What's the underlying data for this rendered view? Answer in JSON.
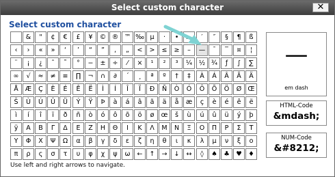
{
  "window": {
    "title": "Select custom character",
    "close_label": "✕"
  },
  "heading": "Select custom character",
  "grid": {
    "columns": 20,
    "highlighted": "—",
    "rows": [
      [
        "",
        "&",
        "\"",
        "¢",
        "€",
        "£",
        "¥",
        "©",
        "®",
        "™",
        "‰",
        "µ",
        "·",
        "•",
        "…",
        "′",
        "″",
        "§",
        "¶",
        "ß"
      ],
      [
        "‹",
        "›",
        "«",
        "»",
        "‘",
        "’",
        "“",
        "”",
        "‚",
        "„",
        "<",
        ">",
        "≤",
        "≥",
        "–",
        "—",
        "¯",
        "‾",
        "¤",
        "¦"
      ],
      [
        "¨",
        "¡",
        "¿",
        "ˆ",
        "˜",
        "°",
        "−",
        "±",
        "÷",
        "⁄",
        "×",
        "¹",
        "²",
        "³",
        "¼",
        "½",
        "¾",
        "ƒ",
        "∫",
        "∑"
      ],
      [
        "∞",
        "√",
        "≈",
        "≠",
        "≡",
        "∏",
        "¬",
        "∩",
        "∂",
        "´",
        "¸",
        "ª",
        "º",
        "†",
        "‡",
        "À",
        "Á",
        "Â",
        "Ã",
        "Ä"
      ],
      [
        "Å",
        "Æ",
        "Ç",
        "È",
        "É",
        "Ê",
        "Ë",
        "Ì",
        "Í",
        "Î",
        "Ï",
        "Ð",
        "Ñ",
        "Ò",
        "Ó",
        "Ô",
        "Õ",
        "Ö",
        "Ø",
        "Œ"
      ],
      [
        "Š",
        "Ù",
        "Ú",
        "Û",
        "Ü",
        "Ý",
        "Ÿ",
        "Þ",
        "à",
        "á",
        "â",
        "ã",
        "ä",
        "å",
        "æ",
        "ç",
        "è",
        "é",
        "ê",
        "ë"
      ],
      [
        "ì",
        "í",
        "î",
        "ï",
        "ð",
        "ñ",
        "ò",
        "ó",
        "ô",
        "õ",
        "ö",
        "ø",
        "œ",
        "š",
        "ù",
        "ú",
        "û",
        "ü",
        "ý",
        "þ"
      ],
      [
        "ÿ",
        "Α",
        "Β",
        "Γ",
        "Δ",
        "Ε",
        "Ζ",
        "Η",
        "Θ",
        "Ι",
        "Κ",
        "Λ",
        "Μ",
        "Ν",
        "Ξ",
        "Ο",
        "Π",
        "Ρ",
        "Σ",
        "Τ"
      ],
      [
        "Υ",
        "Φ",
        "Χ",
        "Ψ",
        "Ω",
        "α",
        "β",
        "γ",
        "δ",
        "ε",
        "ζ",
        "η",
        "θ",
        "ι",
        "κ",
        "λ",
        "μ",
        "ν",
        "ξ",
        "ο"
      ],
      [
        "π",
        "ρ",
        "ς",
        "σ",
        "τ",
        "υ",
        "φ",
        "χ",
        "ψ",
        "ω",
        "←",
        "↑",
        "→",
        "↓",
        "↔",
        "◊",
        "♠",
        "♣",
        "♥",
        "♦"
      ]
    ]
  },
  "hint": "Use left and right arrows to navigate.",
  "preview": {
    "glyph": "—",
    "name": "em dash"
  },
  "html_code": {
    "label": "HTML-Code",
    "value": "&mdash;"
  },
  "num_code": {
    "label": "NUM-Code",
    "value": "&#8212;"
  },
  "colors": {
    "heading": "#1f4f9f",
    "arrow": "#7fd3d3",
    "titlebar": "#4a4a4a"
  }
}
